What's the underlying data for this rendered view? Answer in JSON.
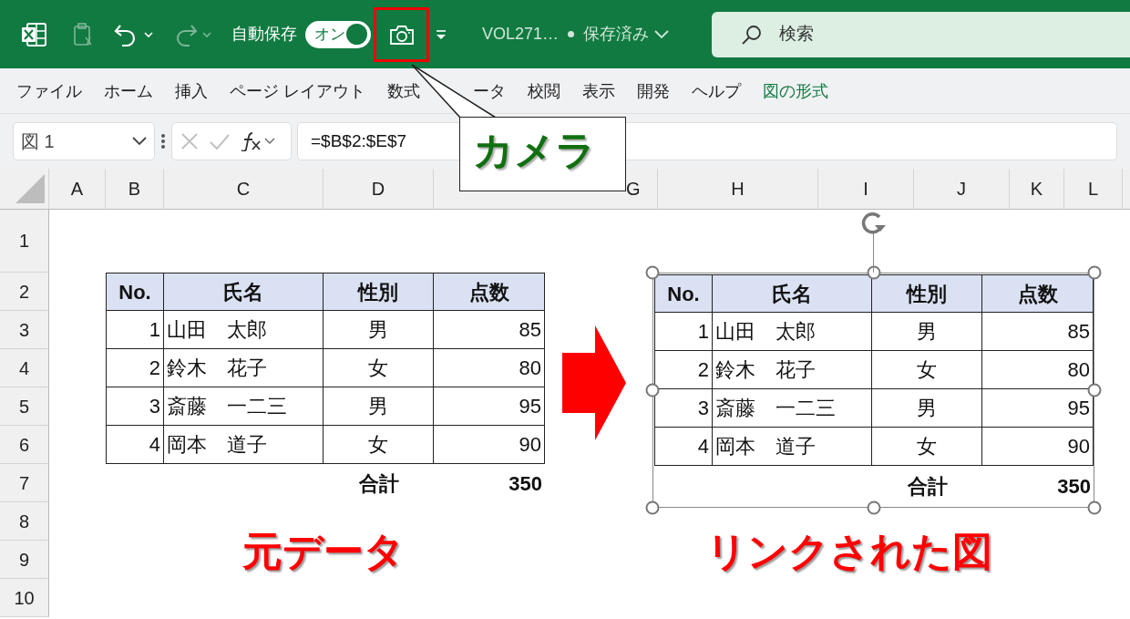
{
  "title_bar": {
    "quick_access": [
      {
        "kind": "paste",
        "disabled": true
      },
      {
        "kind": "undo",
        "disabled": false
      },
      {
        "kind": "redo",
        "disabled": true
      }
    ],
    "autosave": {
      "label": "自動保存",
      "toggle_text": "オン",
      "on": true
    },
    "camera_button": {
      "highlighted": true
    },
    "file_name": "VOL271…",
    "save_status": "保存済み",
    "search": {
      "placeholder": "検索"
    }
  },
  "ribbon_tabs": [
    {
      "label": "ファイル",
      "selected": false,
      "contextual": false
    },
    {
      "label": "ホーム",
      "selected": false,
      "contextual": false
    },
    {
      "label": "挿入",
      "selected": false,
      "contextual": false
    },
    {
      "label": "ページ レイアウト",
      "selected": false,
      "contextual": false
    },
    {
      "label": "数式",
      "selected": false,
      "contextual": false
    },
    {
      "label": "ータ",
      "selected": false,
      "contextual": false
    },
    {
      "label": "校閲",
      "selected": false,
      "contextual": false
    },
    {
      "label": "表示",
      "selected": false,
      "contextual": false
    },
    {
      "label": "開発",
      "selected": false,
      "contextual": false
    },
    {
      "label": "ヘルプ",
      "selected": false,
      "contextual": false
    },
    {
      "label": "図の形式",
      "selected": false,
      "contextual": true
    }
  ],
  "formula_bar": {
    "name_box": "図 1",
    "buttons": [
      {
        "kind": "cancel",
        "disabled": true
      },
      {
        "kind": "enter",
        "disabled": true
      },
      {
        "kind": "function",
        "disabled": false
      }
    ],
    "formula": "=$B$2:$E$7"
  },
  "column_headers": [
    "A",
    "B",
    "C",
    "D",
    "G",
    "H",
    "I",
    "J",
    "K",
    "L"
  ],
  "row_headers": [
    "1",
    "2",
    "3",
    "4",
    "5",
    "6",
    "7",
    "8",
    "9",
    "10"
  ],
  "source_table": {
    "columns": [
      "No.",
      "氏名",
      "性別",
      "点数"
    ],
    "rows": [
      [
        "1",
        "山田　太郎",
        "男",
        "85"
      ],
      [
        "2",
        "鈴木　花子",
        "女",
        "80"
      ],
      [
        "3",
        "斎藤　一二三",
        "男",
        "95"
      ],
      [
        "4",
        "岡本　道子",
        "女",
        "90"
      ]
    ],
    "total": {
      "label": "合計",
      "value": "350"
    }
  },
  "linked_picture": {
    "selected": true,
    "columns": [
      "No.",
      "氏名",
      "性別",
      "点数"
    ],
    "rows": [
      [
        "1",
        "山田　太郎",
        "男",
        "85"
      ],
      [
        "2",
        "鈴木　花子",
        "女",
        "80"
      ],
      [
        "3",
        "斎藤　一二三",
        "男",
        "95"
      ],
      [
        "4",
        "岡本　道子",
        "女",
        "90"
      ]
    ],
    "total": {
      "label": "合計",
      "value": "350"
    }
  },
  "captions": {
    "source": "元データ",
    "linked": "リンクされた図"
  },
  "callout": {
    "text": "カメラ"
  }
}
